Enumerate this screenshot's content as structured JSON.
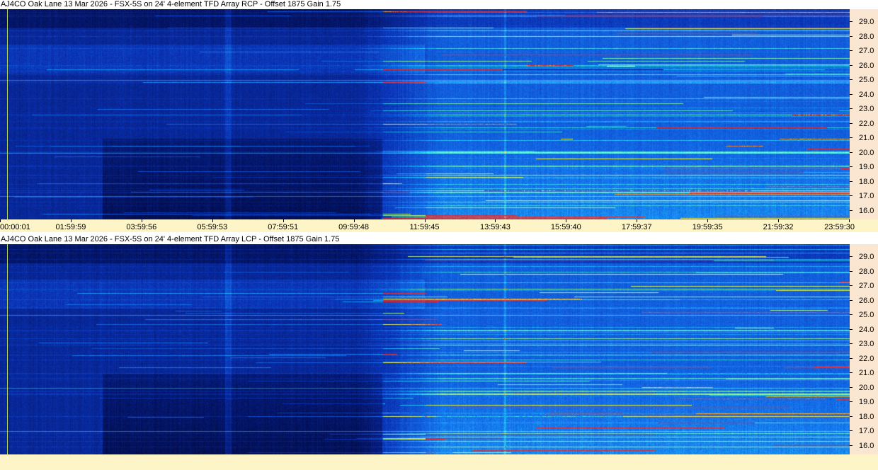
{
  "panels": [
    {
      "title": "AJ4CO Oak Lane 13 Mar 2026 - FSX-5S on 24' 4-element TFD Array RCP  -  Offset 1875  Gain 1.75",
      "polarization": "RCP"
    },
    {
      "title": "AJ4CO Oak Lane 13 Mar 2026 - FSX-5S on 24' 4-element TFD Array LCP  -  Offset 1875  Gain 1.75",
      "polarization": "LCP"
    }
  ],
  "time_labels": [
    "00:00:01",
    "01:59:59",
    "03:59:56",
    "05:59:53",
    "07:59:51",
    "09:59:48",
    "11:59:45",
    "13:59:43",
    "15:59:40",
    "17:59:37",
    "19:59:35",
    "21:59:32",
    "23:59:30"
  ],
  "freq_labels": [
    "29.0",
    "28.0",
    "27.0",
    "26.0",
    "25.0",
    "24.0",
    "23.0",
    "22.0",
    "21.0",
    "20.0",
    "19.0",
    "18.0",
    "17.0",
    "16.0"
  ],
  "colors": {
    "background": "#06227a",
    "freq_axis": "#fbe6d2",
    "time_axis": "#fdf4c8",
    "cursor": "#b8d65a"
  },
  "chart_data": [
    {
      "type": "heatmap",
      "title": "AJ4CO Oak Lane 13 Mar 2026 - FSX-5S on 24' 4-element TFD Array RCP  -  Offset 1875  Gain 1.75",
      "x": [
        "00:00:01",
        "01:59:59",
        "03:59:56",
        "05:59:53",
        "07:59:51",
        "09:59:48",
        "11:59:45",
        "13:59:43",
        "15:59:40",
        "17:59:37",
        "19:59:35",
        "21:59:32",
        "23:59:30"
      ],
      "y": [
        29.0,
        28.0,
        27.0,
        26.0,
        25.0,
        24.0,
        23.0,
        22.0,
        21.0,
        20.0,
        19.0,
        18.0,
        17.0,
        16.0
      ],
      "xlim": [
        "00:00:01",
        "23:59:30"
      ],
      "ylim": [
        15.4,
        29.9
      ],
      "colormap": "dark blue to cyan to yellow to red"
    },
    {
      "type": "heatmap",
      "title": "AJ4CO Oak Lane 13 Mar 2026 - FSX-5S on 24' 4-element TFD Array LCP  -  Offset 1875  Gain 1.75",
      "x": [
        "00:00:01",
        "01:59:59",
        "03:59:56",
        "05:59:53",
        "07:59:51",
        "09:59:48",
        "11:59:45",
        "13:59:43",
        "15:59:40",
        "17:59:37",
        "19:59:35",
        "21:59:32",
        "23:59:30"
      ],
      "y": [
        29.0,
        28.0,
        27.0,
        26.0,
        25.0,
        24.0,
        23.0,
        22.0,
        21.0,
        20.0,
        19.0,
        18.0,
        17.0,
        16.0
      ],
      "xlim": [
        "00:00:01",
        "23:59:30"
      ],
      "ylim": [
        15.4,
        29.9
      ],
      "colormap": "dark blue to cyan to yellow to red"
    }
  ]
}
